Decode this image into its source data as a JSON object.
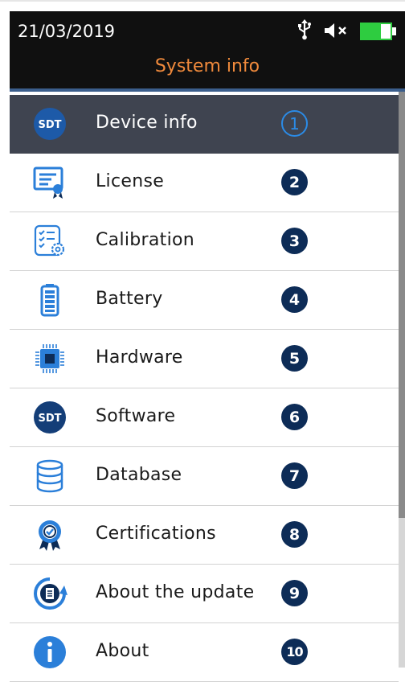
{
  "status_bar": {
    "date": "21/03/2019"
  },
  "header": {
    "title": "System info"
  },
  "menu": [
    {
      "label": "Device info",
      "number": "1",
      "icon": "sdt-logo-icon",
      "selected": true
    },
    {
      "label": "License",
      "number": "2",
      "icon": "license-icon"
    },
    {
      "label": "Calibration",
      "number": "3",
      "icon": "calibration-icon"
    },
    {
      "label": "Battery",
      "number": "4",
      "icon": "battery-icon"
    },
    {
      "label": "Hardware",
      "number": "5",
      "icon": "chip-icon"
    },
    {
      "label": "Software",
      "number": "6",
      "icon": "sdt-logo-icon"
    },
    {
      "label": "Database",
      "number": "7",
      "icon": "database-icon"
    },
    {
      "label": "Certifications",
      "number": "8",
      "icon": "certificate-badge-icon"
    },
    {
      "label": "About the update",
      "number": "9",
      "icon": "update-document-icon"
    },
    {
      "label": "About",
      "number": "10",
      "icon": "info-icon"
    }
  ],
  "colors": {
    "header_bg": "#101010",
    "title": "#f08a3c",
    "selected_bg": "#3f4450",
    "number_badge": "#0d2c57",
    "icon_blue": "#2b7fd9",
    "battery_status": "#2ecc40"
  }
}
